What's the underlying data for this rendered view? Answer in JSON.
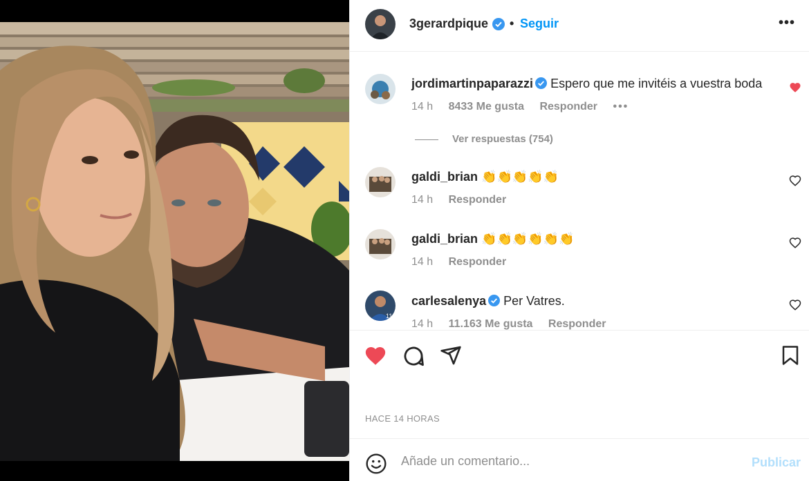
{
  "post": {
    "author": {
      "username": "3gerardpique",
      "verified": true,
      "follow_label": "Seguir",
      "more_icon": "more-horizontal-icon"
    },
    "photo": {
      "description_icon": "photo-couple-selfie"
    }
  },
  "comments": [
    {
      "username": "jordimartinpaparazzi",
      "verified": true,
      "text": "Espero que me invitéis a vuestra boda",
      "time": "14 h",
      "likes": "8433 Me gusta",
      "reply_label": "Responder",
      "liked": true,
      "view_replies": "Ver respuestas (754)"
    },
    {
      "username": "galdi_brian",
      "verified": false,
      "text": "👏👏👏👏👏",
      "time": "14 h",
      "reply_label": "Responder",
      "liked": false
    },
    {
      "username": "galdi_brian",
      "verified": false,
      "text": "👏👏👏👏👏👏",
      "time": "14 h",
      "reply_label": "Responder",
      "liked": false
    },
    {
      "username": "carlesalenya",
      "verified": true,
      "text": "Per Vatres.",
      "time": "14 h",
      "likes": "11.163 Me gusta",
      "reply_label": "Responder",
      "liked": false
    }
  ],
  "actions": {
    "like_icon": "heart-filled-icon",
    "comment_icon": "comment-icon",
    "share_icon": "share-icon",
    "save_icon": "bookmark-icon",
    "liked": true
  },
  "timestamp": "HACE 14 HORAS",
  "add_comment": {
    "emoji_icon": "emoji-icon",
    "placeholder": "Añade un comentario...",
    "publish_label": "Publicar"
  },
  "colors": {
    "accent": "#0095f6",
    "like_red": "#ed4956",
    "verified_blue": "#3897f0",
    "muted": "#8e8e8e",
    "publish_disabled": "#b2dffc"
  }
}
